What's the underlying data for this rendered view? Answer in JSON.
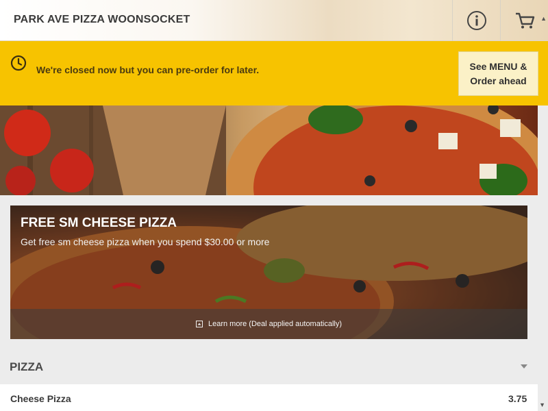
{
  "header": {
    "title": "PARK AVE PIZZA WOONSOCKET"
  },
  "banner": {
    "message": "We're closed now but you can pre-order for later.",
    "button_line1": "See MENU &",
    "button_line2": "Order ahead",
    "color": "#f7c300"
  },
  "deal": {
    "title": "FREE SM CHEESE PIZZA",
    "subtitle": "Get free sm cheese pizza when you spend $30.00 or more",
    "learn_more": "Learn more (Deal applied automatically)"
  },
  "menu": {
    "section_title": "PIZZA",
    "items": [
      {
        "name": "Cheese Pizza",
        "price": "3.75"
      }
    ]
  },
  "icons": [
    "info-icon",
    "cart-icon",
    "clock-icon",
    "expand-icon",
    "chevron-down-icon"
  ]
}
